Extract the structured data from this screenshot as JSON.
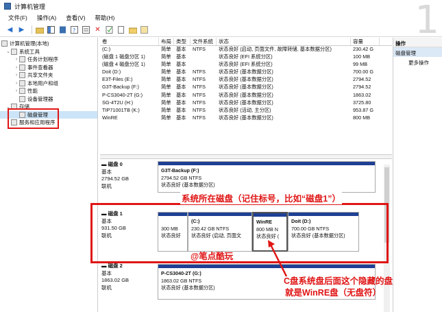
{
  "window": {
    "title": "计算机管理"
  },
  "menu": [
    "文件(F)",
    "操作(A)",
    "查看(V)",
    "帮助(H)"
  ],
  "watermark_digit": "1",
  "tree": {
    "root": "计算机管理(本地)",
    "system_tools": "系统工具",
    "task_scheduler": "任务计划程序",
    "event_viewer": "事件查看器",
    "shared_folders": "共享文件夹",
    "local_users": "本地用户和组",
    "performance": "性能",
    "device_manager": "设备管理器",
    "storage": "存储",
    "disk_management": "磁盘管理",
    "services": "服务和应用程序"
  },
  "volume_table": {
    "headers": [
      "卷",
      "布局",
      "类型",
      "文件系统",
      "状态",
      "容量"
    ],
    "rows": [
      [
        "(C:)",
        "简单",
        "基本",
        "NTFS",
        "状态良好 (启动, 页面文件, 故障转储, 基本数据分区)",
        "230.42 G"
      ],
      [
        "(磁盘 1 磁盘分区 1)",
        "简单",
        "基本",
        "",
        "状态良好 (EFI 系统分区)",
        "100 MB"
      ],
      [
        "(磁盘 4 磁盘分区 1)",
        "简单",
        "基本",
        "",
        "状态良好 (EFI 系统分区)",
        "99 MB"
      ],
      [
        "Doit (D:)",
        "简单",
        "基本",
        "NTFS",
        "状态良好 (基本数据分区)",
        "700.00 G"
      ],
      [
        "E3T-Files (E:)",
        "简单",
        "基本",
        "NTFS",
        "状态良好 (基本数据分区)",
        "2794.52"
      ],
      [
        "G3T-Backup (F:)",
        "简单",
        "基本",
        "NTFS",
        "状态良好 (基本数据分区)",
        "2794.52"
      ],
      [
        "P-CS3040-2T (G:)",
        "简单",
        "基本",
        "NTFS",
        "状态良好 (基本数据分区)",
        "1863.02"
      ],
      [
        "SG-4T2U (H:)",
        "简单",
        "基本",
        "NTFS",
        "状态良好 (基本数据分区)",
        "3725.80"
      ],
      [
        "TIP71001TB (K:)",
        "简单",
        "基本",
        "NTFS",
        "状态良好 (活动, 主分区)",
        "953.87 G"
      ],
      [
        "WinRE",
        "简单",
        "基本",
        "NTFS",
        "状态良好 (基本数据分区)",
        "800 MB"
      ]
    ]
  },
  "disks": {
    "disk0": {
      "name": "磁盘 0",
      "type": "基本",
      "size": "2794.52 GB",
      "status": "联机",
      "part": {
        "name": "G3T-Backup (F:)",
        "detail": "2794.52 GB NTFS",
        "status": "状态良好 (基本数据分区)"
      }
    },
    "disk1": {
      "name": "磁盘 1",
      "type": "基本",
      "size": "931.50 GB",
      "status": "联机",
      "parts": [
        {
          "name": "",
          "detail": "300 MB",
          "status": "状态良好"
        },
        {
          "name": "(C:)",
          "detail": "230.42 GB NTFS",
          "status": "状态良好 (启动, 页面文"
        },
        {
          "name": "WinRE",
          "detail": "800 MB N",
          "status": "状态良好 ("
        },
        {
          "name": "Doit (D:)",
          "detail": "700.00 GB NTFS",
          "status": "状态良好 (基本数据分区)"
        }
      ]
    },
    "disk2": {
      "name": "磁盘 2",
      "type": "基本",
      "size": "1863.02 GB",
      "status": "联机",
      "part": {
        "name": "P-CS3040-2T (G:)",
        "detail": "1863.02 GB NTFS",
        "status": "状态良好 (基本数据分区)"
      }
    }
  },
  "actions": {
    "header": "操作",
    "item": "磁盘管理",
    "more": "更多操作"
  },
  "annotations": {
    "system_disk": "系统所在磁盘（记住标号，比如“磁盘1”）",
    "author": "@笔点酷玩",
    "winre_line1": "C盘系统盘后面这个隐藏的盘",
    "winre_line2": "就是WinRE盘（无盘符）"
  },
  "colors": {
    "partition_bar": "#1e3f94",
    "annotation": "#e01515",
    "selection": "#cce4f7"
  }
}
